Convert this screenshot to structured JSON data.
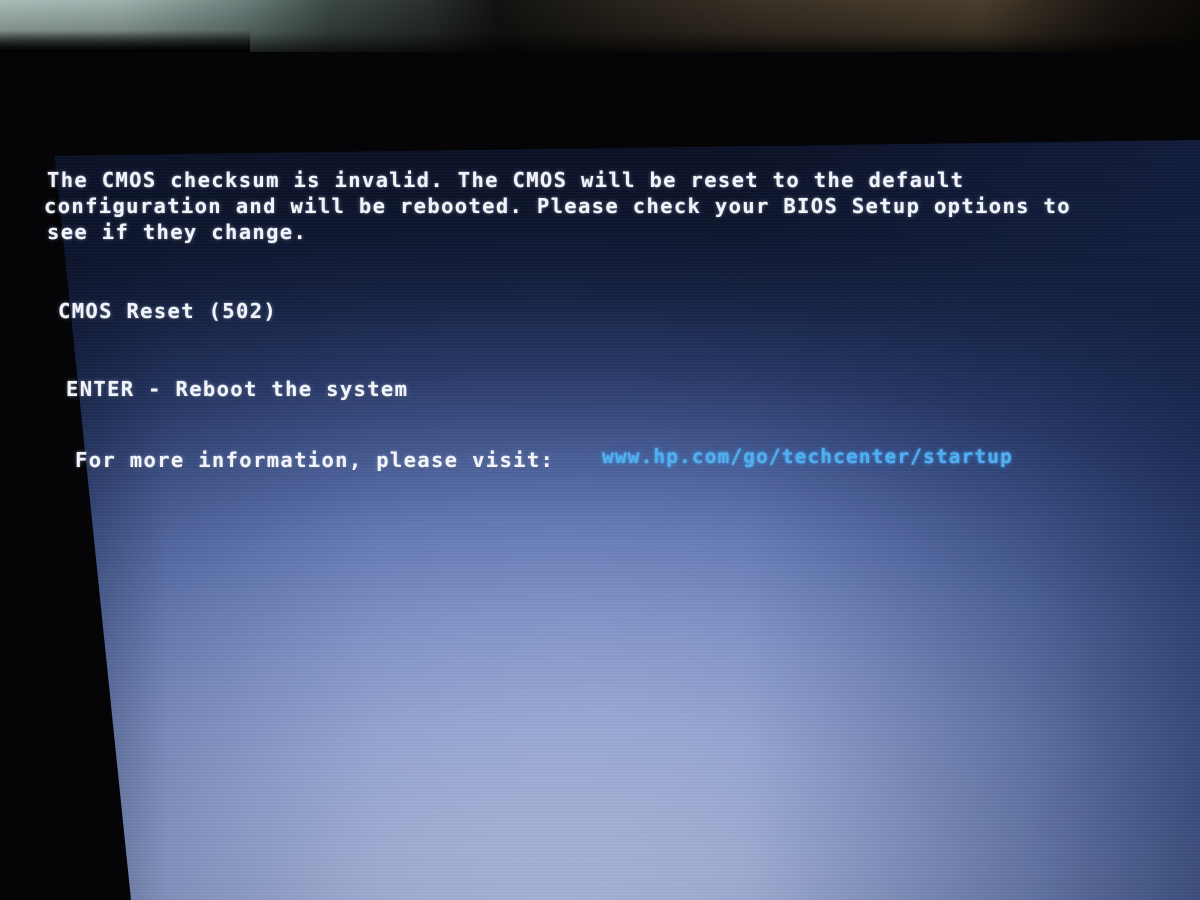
{
  "device": {
    "kind": "monitor-photograph",
    "vendor": "HP",
    "screen_kind": "bios-post-message"
  },
  "screen": {
    "message_lines": [
      "The CMOS checksum is invalid. The CMOS will be reset to the default",
      "configuration and will be rebooted. Please check your BIOS Setup options to",
      "see if they change."
    ],
    "error_code_line": "CMOS Reset (502)",
    "key_action_line": "ENTER - Reboot the system",
    "info_prompt": "For more information, please visit:",
    "info_url": "www.hp.com/go/techcenter/startup"
  },
  "colors": {
    "text": "#f2f4fb",
    "url": "#4fb0ef",
    "screen_top": "#101a31",
    "screen_bottom": "#c2cdee",
    "bezel": "#060608"
  }
}
